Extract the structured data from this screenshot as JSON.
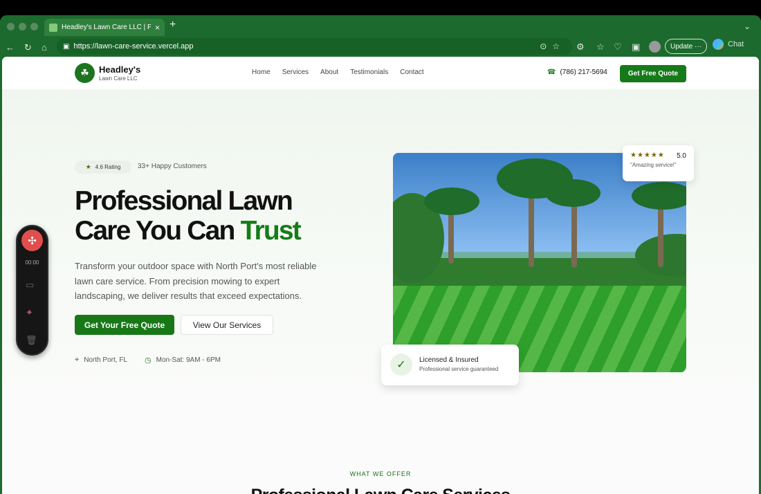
{
  "browser": {
    "tab_title": "Headley's Lawn Care LLC | Profe",
    "url": "https://lawn-care-service.vercel.app",
    "update_label": "Update",
    "chat_label": "Chat"
  },
  "site": {
    "brand_name": "Headley's",
    "brand_subtitle": "Lawn Care LLC",
    "nav": [
      "Home",
      "Services",
      "About",
      "Testimonials",
      "Contact"
    ],
    "phone": "(786) 217-5694",
    "header_cta": "Get Free Quote"
  },
  "hero": {
    "rating": "4.6 Rating",
    "customers": "33+ Happy Customers",
    "title_part1": "Professional Lawn",
    "title_part2": "Care You Can",
    "title_accent": "Trust",
    "description": "Transform your outdoor space with North Port's most reliable lawn care service. From precision mowing to expert landscaping, we deliver results that exceed expectations.",
    "primary_button": "Get Your Free Quote",
    "secondary_button": "View Our Services",
    "location": "North Port, FL",
    "hours": "Mon-Sat: 9AM - 6PM"
  },
  "review": {
    "score": "5.0",
    "quote": "\"Amazing service!\""
  },
  "badge": {
    "title": "Licensed & Insured",
    "subtitle": "Professional service guaranteed"
  },
  "services": {
    "kicker": "WHAT WE OFFER",
    "title": "Professional Lawn Care Services"
  },
  "recorder": {
    "time": "00:00"
  }
}
